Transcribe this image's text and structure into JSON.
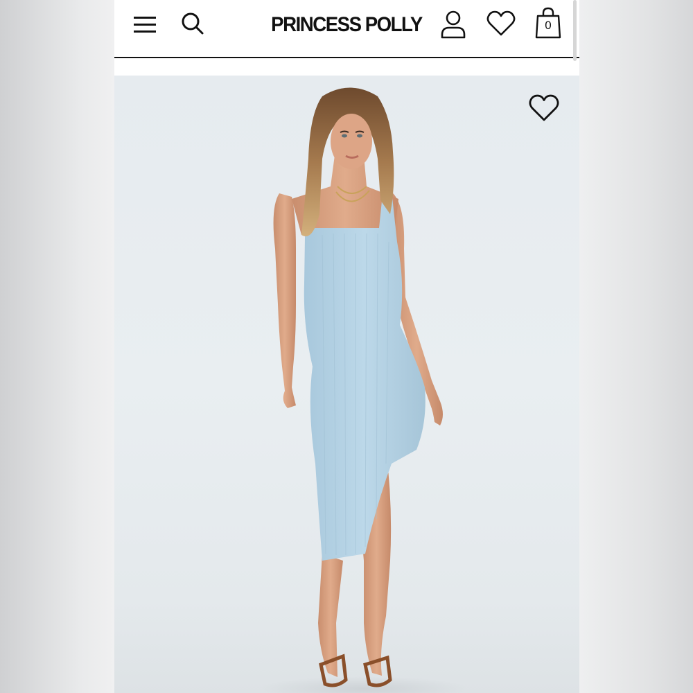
{
  "header": {
    "brand": "PRINCESS POLLY",
    "bag_count": "0"
  },
  "icons": {
    "menu": "hamburger-menu-icon",
    "search": "search-icon",
    "account": "user-icon",
    "wishlist": "heart-icon",
    "bag": "shopping-bag-icon",
    "image_wishlist": "heart-icon"
  },
  "product": {
    "image_colors": {
      "dress": "#b7d4e6",
      "background": "#e7ecef",
      "skin": "#d9a283",
      "hair": "#8a5d3b"
    }
  }
}
